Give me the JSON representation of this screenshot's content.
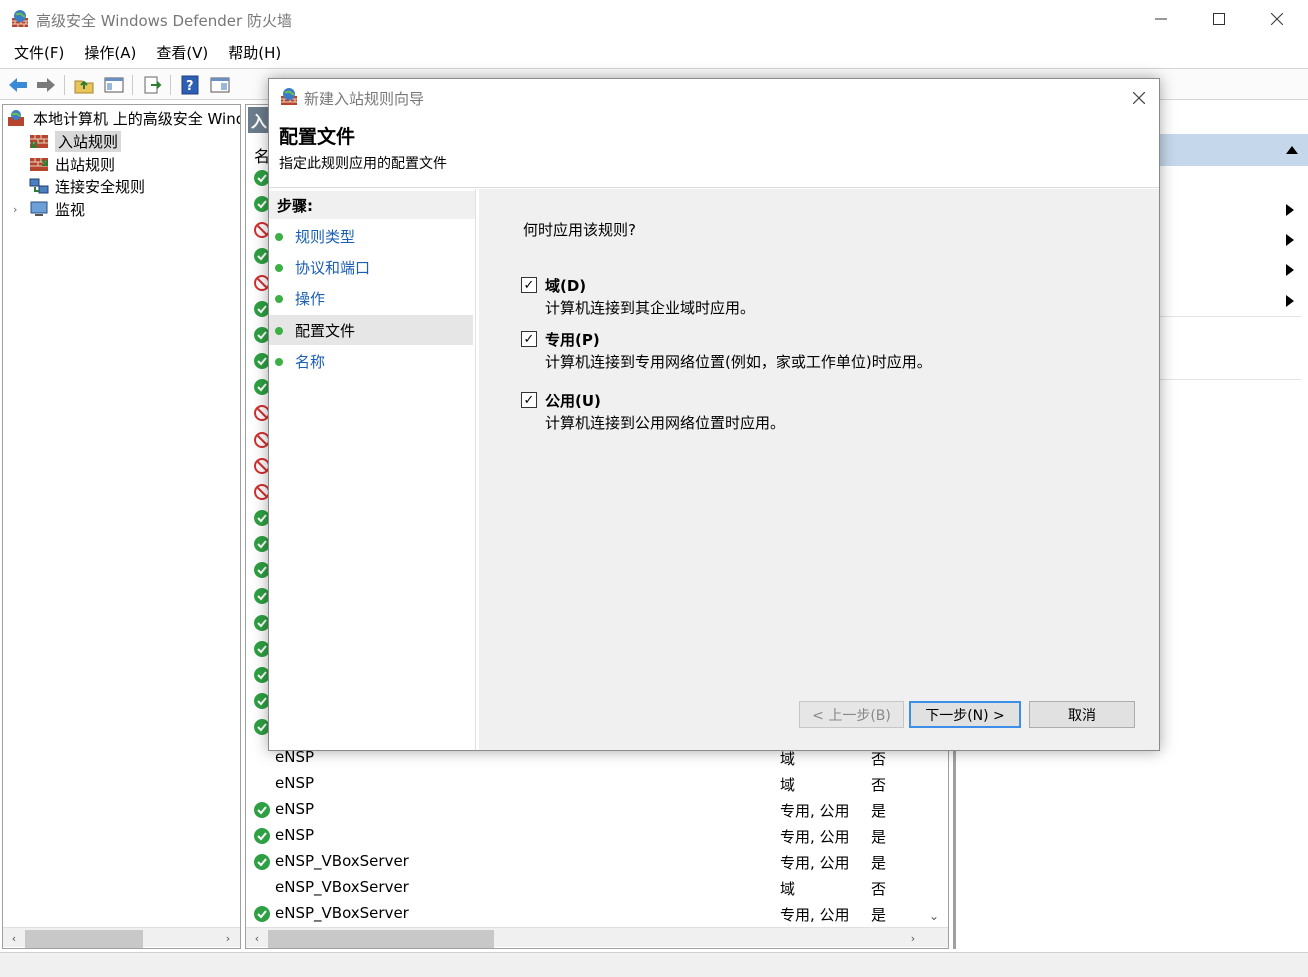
{
  "window": {
    "title": "高级安全 Windows Defender 防火墙",
    "menu": [
      "文件(F)",
      "操作(A)",
      "查看(V)",
      "帮助(H)"
    ]
  },
  "tree": {
    "root": "本地计算机 上的高级安全 Windo",
    "items": [
      "入站规则",
      "出站规则",
      "连接安全规则",
      "监视"
    ]
  },
  "list": {
    "tab_letter": "入",
    "col_name_fragment": "名",
    "visible_rows": [
      {
        "name": "eNSP",
        "profile": "域",
        "enabled": "否",
        "icon": "none"
      },
      {
        "name": "eNSP",
        "profile": "域",
        "enabled": "否",
        "icon": "none"
      },
      {
        "name": "eNSP",
        "profile": "专用, 公用",
        "enabled": "是",
        "icon": "allow-check-icon"
      },
      {
        "name": "eNSP",
        "profile": "专用, 公用",
        "enabled": "是",
        "icon": "allow-check-icon"
      },
      {
        "name": "eNSP_VBoxServer",
        "profile": "专用, 公用",
        "enabled": "是",
        "icon": "allow-check-icon"
      },
      {
        "name": "eNSP_VBoxServer",
        "profile": "域",
        "enabled": "否",
        "icon": "none"
      },
      {
        "name": "eNSP_VBoxServer",
        "profile": "专用, 公用",
        "enabled": "是",
        "icon": "allow-check-icon"
      }
    ],
    "hidden_row_icons": [
      "allow",
      "allow",
      "block",
      "allow",
      "block",
      "allow",
      "allow",
      "allow",
      "allow",
      "block",
      "block",
      "block",
      "block",
      "allow",
      "allow",
      "allow",
      "allow",
      "allow",
      "allow",
      "allow",
      "allow",
      "allow"
    ]
  },
  "dialog": {
    "title": "新建入站规则向导",
    "heading": "配置文件",
    "subheading": "指定此规则应用的配置文件",
    "steps_header": "步骤:",
    "steps": [
      {
        "label": "规则类型",
        "current": false
      },
      {
        "label": "协议和端口",
        "current": false
      },
      {
        "label": "操作",
        "current": false
      },
      {
        "label": "配置文件",
        "current": true
      },
      {
        "label": "名称",
        "current": false
      }
    ],
    "question": "何时应用该规则?",
    "options": [
      {
        "label": "域(D)",
        "desc": "计算机连接到其企业域时应用。",
        "checked": true
      },
      {
        "label": "专用(P)",
        "desc": "计算机连接到专用网络位置(例如，家或工作单位)时应用。",
        "checked": true
      },
      {
        "label": "公用(U)",
        "desc": "计算机连接到公用网络位置时应用。",
        "checked": true
      }
    ],
    "buttons": {
      "back": "< 上一步(B)",
      "next": "下一步(N) >",
      "cancel": "取消"
    }
  },
  "colors": {
    "accent": "#3c8ee6",
    "link": "#1a5fb4",
    "step_dot": "#3cb043",
    "allow": "#2ea043",
    "block": "#d32f2f"
  }
}
